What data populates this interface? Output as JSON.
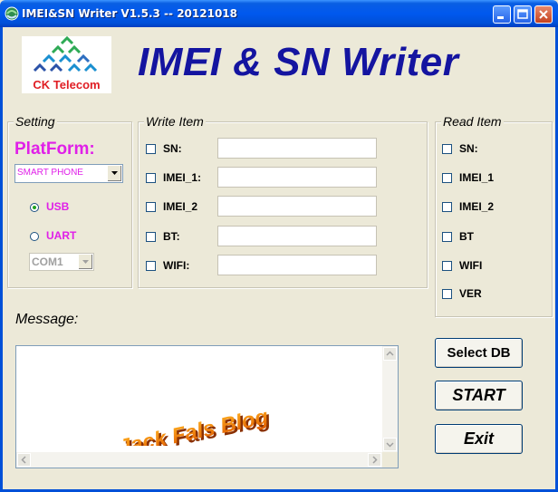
{
  "window": {
    "title": "IMEI&SN Writer V1.5.3 -- 20121018"
  },
  "logo": {
    "text": "CK Telecom"
  },
  "app_title": "IMEI & SN Writer",
  "setting": {
    "legend": "Setting",
    "platform_label": "PlatForm:",
    "platform_value": "SMART PHONE",
    "connection_options": [
      {
        "label": "USB",
        "selected": true
      },
      {
        "label": "UART",
        "selected": false
      }
    ],
    "com_port": "COM1"
  },
  "write_item": {
    "legend": "Write Item",
    "items": [
      {
        "label": "SN:",
        "checked": false,
        "value": ""
      },
      {
        "label": "IMEI_1:",
        "checked": false,
        "value": ""
      },
      {
        "label": "IMEI_2",
        "checked": false,
        "value": ""
      },
      {
        "label": "BT:",
        "checked": false,
        "value": ""
      },
      {
        "label": "WIFI:",
        "checked": false,
        "value": ""
      }
    ]
  },
  "read_item": {
    "legend": "Read Item",
    "items": [
      {
        "label": "SN:",
        "checked": false
      },
      {
        "label": "IMEI_1",
        "checked": false
      },
      {
        "label": "IMEI_2",
        "checked": false
      },
      {
        "label": "BT",
        "checked": false
      },
      {
        "label": "WIFI",
        "checked": false
      },
      {
        "label": "VER",
        "checked": false
      }
    ]
  },
  "message": {
    "label": "Message:",
    "content": "",
    "watermark": "Jack Fals Blog"
  },
  "buttons": {
    "select_db": "Select DB",
    "start": "START",
    "exit": "Exit"
  },
  "colors": {
    "title_blue": "#1414a0",
    "magenta": "#e020e8",
    "brand_red": "#e01e24",
    "xp_blue": "#0050d8"
  },
  "icons": {
    "window": "app-icon",
    "minimize": "minimize-icon",
    "maximize": "maximize-icon",
    "close": "close-icon",
    "logo": "ck-telecom-logo"
  }
}
